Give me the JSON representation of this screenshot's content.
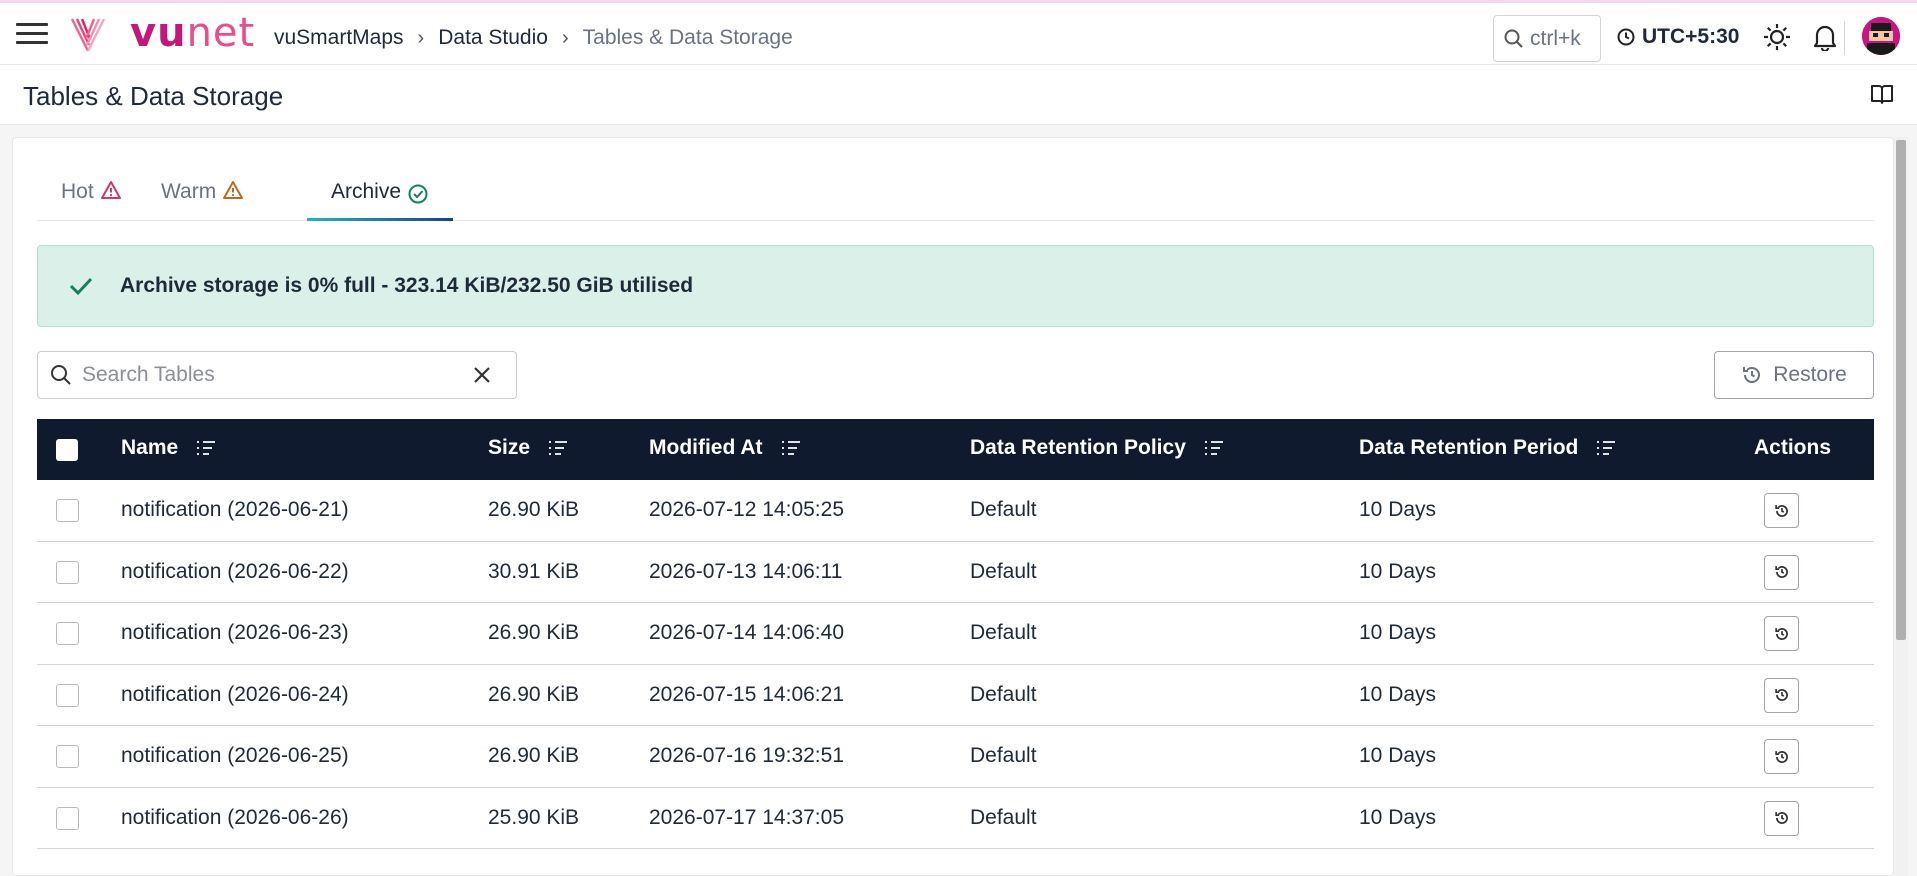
{
  "topbar": {
    "brand": {
      "part1": "vu",
      "part2": "net"
    },
    "breadcrumb": [
      "vuSmartMaps",
      "Data Studio",
      "Tables & Data Storage"
    ],
    "search_shortcut": "ctrl+k",
    "timezone": "UTC+5:30"
  },
  "page": {
    "title": "Tables & Data Storage"
  },
  "tabs": [
    {
      "label": "Hot",
      "status_icon": "warning-icon",
      "color": "#d6336c"
    },
    {
      "label": "Warm",
      "status_icon": "warning-icon",
      "color": "#c26a1c"
    },
    {
      "label": "Archive",
      "status_icon": "check-circle-icon",
      "color": "#16805c",
      "active": true
    }
  ],
  "alert": {
    "text": "Archive storage is 0% full - 323.14 KiB/232.50 GiB utilised",
    "color": "#16805c"
  },
  "search": {
    "placeholder": "Search Tables",
    "value": ""
  },
  "restore_label": "Restore",
  "table": {
    "columns": [
      "Name",
      "Size",
      "Modified At",
      "Data Retention Policy",
      "Data Retention Period",
      "Actions"
    ],
    "rows": [
      {
        "name": "notification (2026-06-21)",
        "size": "26.90 KiB",
        "modified": "2026-07-12 14:05:25",
        "policy": "Default",
        "period": "10 Days"
      },
      {
        "name": "notification (2026-06-22)",
        "size": "30.91 KiB",
        "modified": "2026-07-13 14:06:11",
        "policy": "Default",
        "period": "10 Days"
      },
      {
        "name": "notification (2026-06-23)",
        "size": "26.90 KiB",
        "modified": "2026-07-14 14:06:40",
        "policy": "Default",
        "period": "10 Days"
      },
      {
        "name": "notification (2026-06-24)",
        "size": "26.90 KiB",
        "modified": "2026-07-15 14:06:21",
        "policy": "Default",
        "period": "10 Days"
      },
      {
        "name": "notification (2026-06-25)",
        "size": "26.90 KiB",
        "modified": "2026-07-16 19:32:51",
        "policy": "Default",
        "period": "10 Days"
      },
      {
        "name": "notification (2026-06-26)",
        "size": "25.90 KiB",
        "modified": "2026-07-17 14:37:05",
        "policy": "Default",
        "period": "10 Days"
      }
    ]
  },
  "colors": {
    "brand": "#c2187a",
    "table_header": "#0f1a2e",
    "alert_bg": "#daf0e8"
  }
}
